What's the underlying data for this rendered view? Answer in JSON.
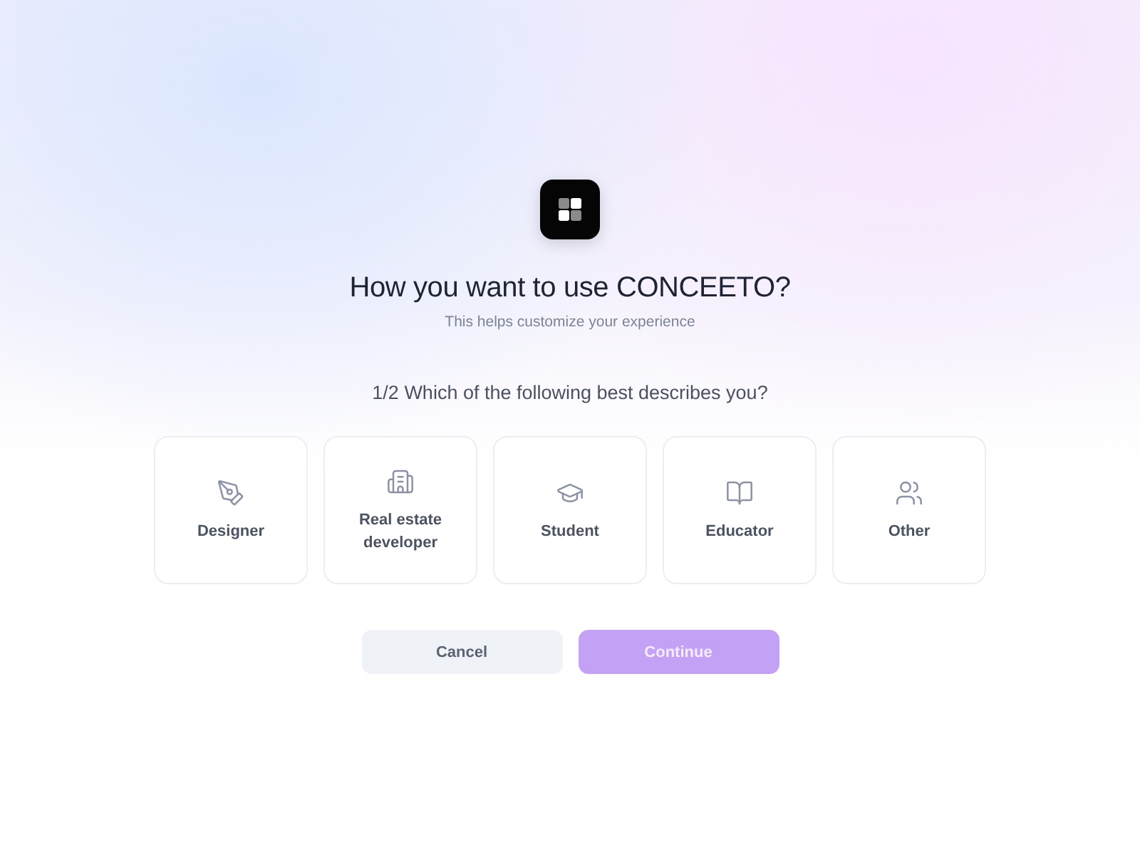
{
  "header": {
    "title": "How you want to use CONCEETO?",
    "subtitle": "This helps customize your experience"
  },
  "question": "1/2 Which of the following best describes you?",
  "options": [
    {
      "label": "Designer",
      "selected": false
    },
    {
      "label": "Real estate developer",
      "selected": false
    },
    {
      "label": "Student",
      "selected": false
    },
    {
      "label": "Educator",
      "selected": false
    },
    {
      "label": "Other",
      "selected": false
    }
  ],
  "buttons": [
    {
      "label": "Cancel",
      "kind": "secondary",
      "disabled": false
    },
    {
      "label": "Continue",
      "kind": "primary",
      "disabled": true
    }
  ]
}
